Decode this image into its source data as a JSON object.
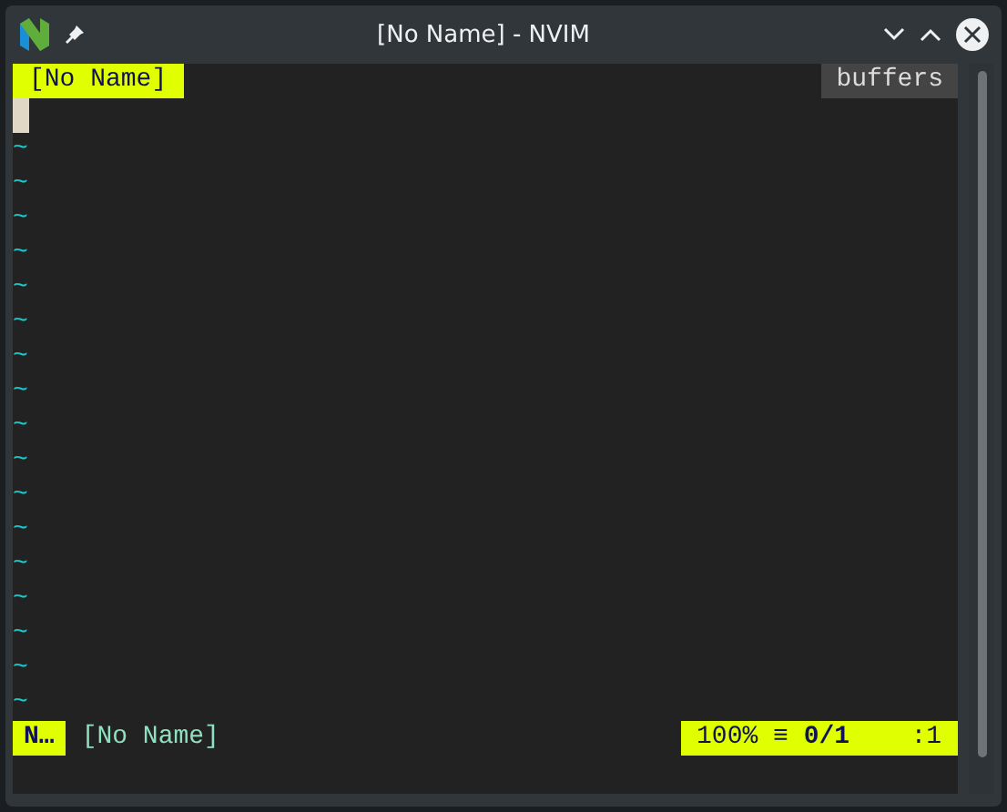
{
  "window": {
    "title": "[No Name] - NVIM"
  },
  "tabline": {
    "tabs": [
      {
        "label": "[No Name]",
        "selected": true
      }
    ],
    "right_label": "buffers"
  },
  "buffer": {
    "cursor": true,
    "filler_lines": [
      "~",
      "~",
      "~",
      "~",
      "~",
      "~",
      "~",
      "~",
      "~",
      "~",
      "~",
      "~",
      "~",
      "~",
      "~",
      "~",
      "~"
    ]
  },
  "statusline": {
    "mode": "N…",
    "filename": "[No Name]",
    "percent": "100%",
    "line_icon": "≡",
    "line_position": "0/1",
    "column": ":1"
  }
}
